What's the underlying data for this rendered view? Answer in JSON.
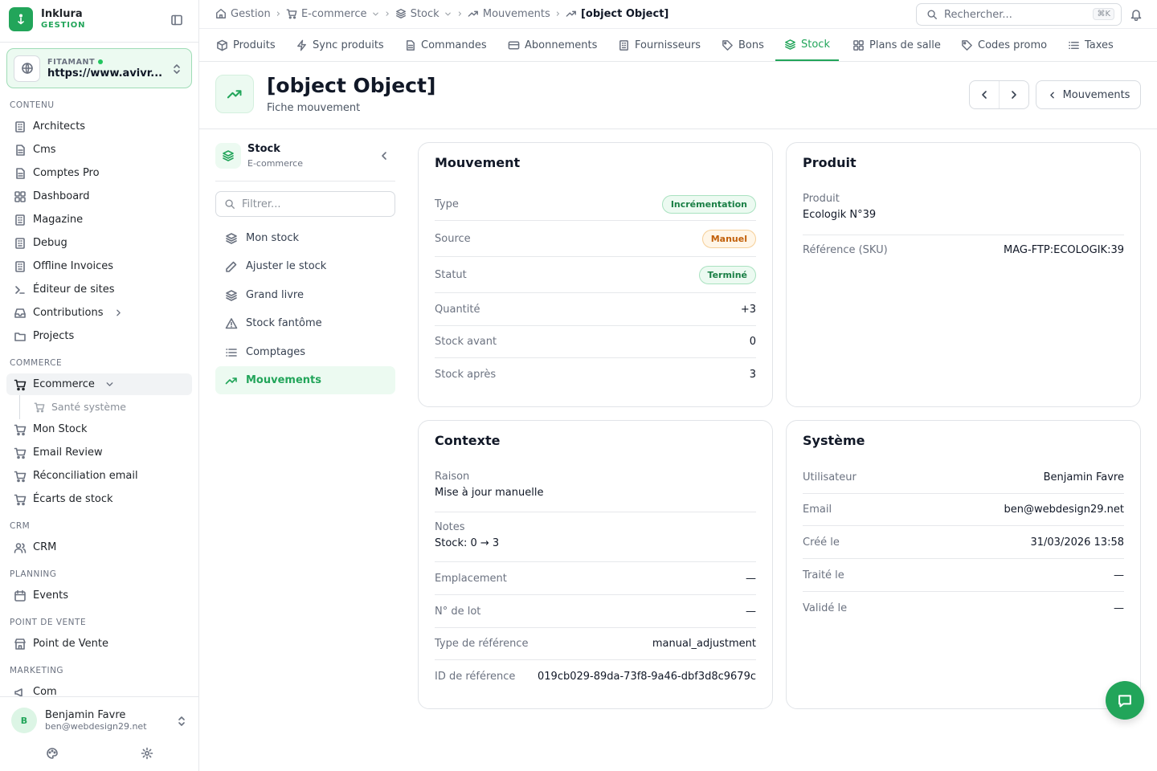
{
  "brand": {
    "name": "Inklura",
    "sub": "GESTION"
  },
  "site": {
    "label": "FITAMANT",
    "url": "https://www.avivr..."
  },
  "sidebar": {
    "sections": {
      "contenu": "CONTENU",
      "commerce": "COMMERCE",
      "crm": "CRM",
      "planning": "PLANNING",
      "pos": "POINT DE VENTE",
      "marketing": "MARKETING"
    },
    "contenu_items": [
      {
        "label": "Architects",
        "icon": "building-icon"
      },
      {
        "label": "Cms",
        "icon": "document-icon"
      },
      {
        "label": "Comptes Pro",
        "icon": "document-icon"
      },
      {
        "label": "Dashboard",
        "icon": "grid-icon"
      },
      {
        "label": "Magazine",
        "icon": "building-icon"
      },
      {
        "label": "Debug",
        "icon": "building-icon"
      },
      {
        "label": "Offline Invoices",
        "icon": "building-icon"
      },
      {
        "label": "Éditeur de sites",
        "icon": "terminal-icon"
      },
      {
        "label": "Contributions",
        "icon": "inbox-icon"
      },
      {
        "label": "Projects",
        "icon": "folder-icon"
      }
    ],
    "ecommerce": {
      "label": "Ecommerce",
      "sub": "Santé système"
    },
    "commerce_items": [
      {
        "label": "Mon Stock"
      },
      {
        "label": "Email Review"
      },
      {
        "label": "Réconciliation email"
      },
      {
        "label": "Écarts de stock"
      }
    ],
    "crm": "CRM",
    "events": "Events",
    "pos": "Point de Vente",
    "com": "Com"
  },
  "user": {
    "initial": "B",
    "name": "Benjamin Favre",
    "email": "ben@webdesign29.net"
  },
  "breadcrumb": [
    "Gestion",
    "E-commerce",
    "Stock",
    "Mouvements",
    "[object Object]"
  ],
  "search": {
    "placeholder": "Rechercher...",
    "shortcut": "⌘K"
  },
  "tabs": [
    {
      "label": "Produits",
      "icon": "box-icon"
    },
    {
      "label": "Sync produits",
      "icon": "bolt-icon"
    },
    {
      "label": "Commandes",
      "icon": "document-icon"
    },
    {
      "label": "Abonnements",
      "icon": "card-icon"
    },
    {
      "label": "Fournisseurs",
      "icon": "building-icon"
    },
    {
      "label": "Bons",
      "icon": "tag-icon"
    },
    {
      "label": "Stock",
      "icon": "layers-icon",
      "active": true
    },
    {
      "label": "Plans de salle",
      "icon": "grid-icon"
    },
    {
      "label": "Codes promo",
      "icon": "tag-icon"
    },
    {
      "label": "Taxes",
      "icon": "list-icon"
    }
  ],
  "page": {
    "title": "[object Object]",
    "subtitle": "Fiche mouvement",
    "back_label": "Mouvements"
  },
  "subnav": {
    "title": "Stock",
    "subtitle": "E-commerce",
    "filter_placeholder": "Filtrer...",
    "items": [
      {
        "label": "Mon stock"
      },
      {
        "label": "Ajuster le stock"
      },
      {
        "label": "Grand livre"
      },
      {
        "label": "Stock fantôme"
      },
      {
        "label": "Comptages"
      },
      {
        "label": "Mouvements",
        "active": true
      }
    ]
  },
  "mouvement": {
    "title": "Mouvement",
    "type_label": "Type",
    "type_value": "Incrémentation",
    "source_label": "Source",
    "source_value": "Manuel",
    "statut_label": "Statut",
    "statut_value": "Terminé",
    "quantite_label": "Quantité",
    "quantite_value": "+3",
    "avant_label": "Stock avant",
    "avant_value": "0",
    "apres_label": "Stock après",
    "apres_value": "3"
  },
  "produit": {
    "title": "Produit",
    "produit_label": "Produit",
    "produit_value": "Ecologik N°39",
    "sku_label": "Référence (SKU)",
    "sku_value": "MAG-FTP:ECOLOGIK:39"
  },
  "contexte": {
    "title": "Contexte",
    "raison_label": "Raison",
    "raison_value": "Mise à jour manuelle",
    "notes_label": "Notes",
    "notes_value": "Stock: 0 → 3",
    "emplacement_label": "Emplacement",
    "emplacement_value": "—",
    "lot_label": "N° de lot",
    "lot_value": "—",
    "reftype_label": "Type de référence",
    "reftype_value": "manual_adjustment",
    "refid_label": "ID de référence",
    "refid_value": "019cb029-89da-73f8-9a46-dbf3d8c9679c"
  },
  "systeme": {
    "title": "Système",
    "user_label": "Utilisateur",
    "user_value": "Benjamin Favre",
    "email_label": "Email",
    "email_value": "ben@webdesign29.net",
    "cree_label": "Créé le",
    "cree_value": "31/03/2026 13:58",
    "traite_label": "Traité le",
    "traite_value": "—",
    "valide_label": "Validé le",
    "valide_value": "—"
  },
  "colors": {
    "accent": "#22a55a",
    "accent_bg": "#ecfaf1",
    "warning": "#c2600a"
  }
}
